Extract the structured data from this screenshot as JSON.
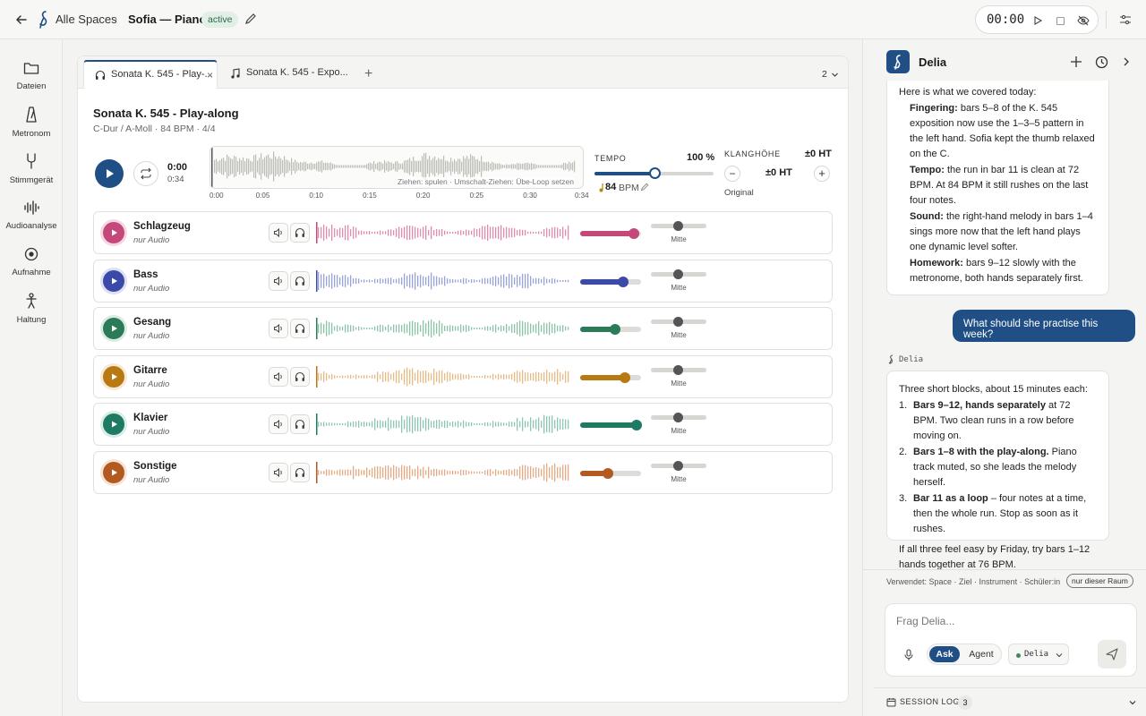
{
  "topbar": {
    "crumb_spaces": "Alle Spaces",
    "crumb_sep": "›",
    "title": "Sofia — Piano",
    "status": "active",
    "timer": "00:00"
  },
  "rail": [
    {
      "label": "Dateien",
      "icon": "folder-icon"
    },
    {
      "label": "Metronom",
      "icon": "metronome-icon"
    },
    {
      "label": "Stimmgerät",
      "icon": "tuning-fork-icon"
    },
    {
      "label": "Audioanalyse",
      "icon": "audio-wave-icon"
    },
    {
      "label": "Aufnahme",
      "icon": "record-icon"
    },
    {
      "label": "Haltung",
      "icon": "posture-icon"
    }
  ],
  "tabs": [
    {
      "label": "Sonata K. 545 - Play-...",
      "close": "×"
    },
    {
      "label": "Sonata K. 545 - Expo..."
    }
  ],
  "tab_add": "+",
  "tab_count": "2",
  "song": {
    "title": "Sonata K. 545 - Play-along",
    "meta": "C-Dur / A-Moll · 84 BPM · 4/4",
    "time_current": "0:00",
    "time_total": "0:34",
    "wave_hint": "Ziehen: spulen · Umschalt-Ziehen: Übe-Loop setzen",
    "ticks": [
      "0:00",
      "0:05",
      "0:10",
      "0:15",
      "0:20",
      "0:25",
      "0:30",
      "0:34"
    ]
  },
  "tempo": {
    "label": "TEMPO",
    "percent": "100 %",
    "level": 0.5,
    "bpm": "84",
    "unit": "BPM"
  },
  "pitch": {
    "label": "KLANGHÖHE",
    "header_value": "±0 HT",
    "minus": "−",
    "value": "±0 HT",
    "plus": "+",
    "sub": "Original"
  },
  "tracks": [
    {
      "name": "Schlagzeug",
      "sub": "nur Audio",
      "color": "#c4487a",
      "wave": "#e08aae",
      "volume": 0.88,
      "pan_label": "Mitte"
    },
    {
      "name": "Bass",
      "sub": "nur Audio",
      "color": "#3b4aa8",
      "wave": "#9aa3d9",
      "volume": 0.7,
      "pan_label": "Mitte"
    },
    {
      "name": "Gesang",
      "sub": "nur Audio",
      "color": "#2b7a58",
      "wave": "#8cc4aa",
      "volume": 0.57,
      "pan_label": "Mitte"
    },
    {
      "name": "Gitarre",
      "sub": "nur Audio",
      "color": "#b87913",
      "wave": "#e6bb86",
      "volume": 0.74,
      "pan_label": "Mitte"
    },
    {
      "name": "Klavier",
      "sub": "nur Audio",
      "color": "#1f7a63",
      "wave": "#8ec6b5",
      "volume": 0.93,
      "pan_label": "Mitte"
    },
    {
      "name": "Sonstige",
      "sub": "nur Audio",
      "color": "#b35a22",
      "wave": "#e6aa86",
      "volume": 0.45,
      "pan_label": "Mitte"
    }
  ],
  "panel": {
    "title": "Delia",
    "msg1": {
      "intro": "Here is what we covered today:",
      "items": [
        {
          "b": "Fingering:",
          "t": " bars 5–8 of the K. 545 exposition now use the 1–3–5 pattern in the left hand. Sofia kept the thumb relaxed on the C."
        },
        {
          "b": "Tempo:",
          "t": " the run in bar 11 is clean at 72 BPM. At 84 BPM it still rushes on the last four notes."
        },
        {
          "b": "Sound:",
          "t": " the right-hand melody in bars 1–4 sings more now that the left hand plays one dynamic level softer."
        },
        {
          "b": "Homework:",
          "t": " bars 9–12 slowly with the metronome, both hands separately first."
        }
      ]
    },
    "user_msg": "What should she practise this week?",
    "assistant_label": "Delia",
    "msg2": {
      "intro": "Three short blocks, about 15 minutes each:",
      "items": [
        {
          "n": "1.",
          "b": "Bars 9–12, hands separately",
          "t": " at 72 BPM. Two clean runs in a row before moving on."
        },
        {
          "n": "2.",
          "b": "Bars 1–8 with the play-along.",
          "t": " Piano track muted, so she leads the melody herself."
        },
        {
          "n": "3.",
          "b": "Bar 11 as a loop",
          "t": " – four notes at a time, then the whole run. Stop as soon as it rushes."
        }
      ],
      "outro": "If all three feel easy by Friday, try bars 1–12 hands together at 76 BPM."
    },
    "context": "Verwendet: Space · Ziel · Instrument · Schüler:in",
    "context_pill": "nur dieser Raum",
    "input_placeholder": "Frag Delia...",
    "mode_ask": "Ask",
    "mode_agent": "Agent",
    "model": "Delia",
    "session_label": "SESSION LOG",
    "session_count": "3"
  },
  "colors": {
    "accent": "#1f4f85",
    "active_badge": "#e1efe6"
  }
}
